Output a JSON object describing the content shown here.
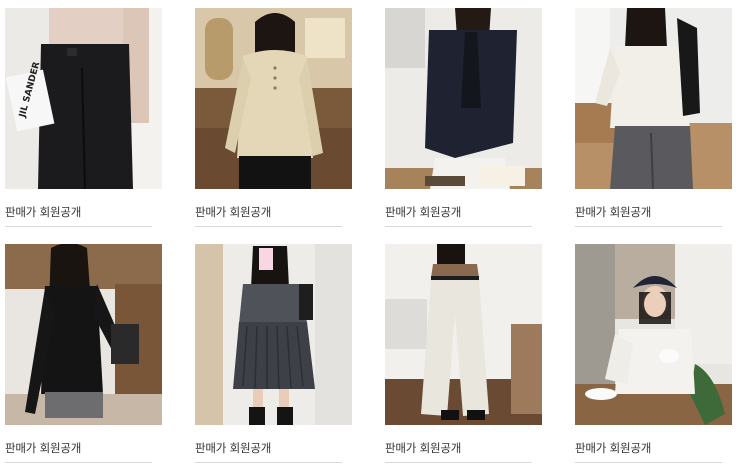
{
  "products": [
    {
      "price_label": "판매가 회원공개",
      "icon": "product-photo"
    },
    {
      "price_label": "판매가 회원공개",
      "icon": "product-photo"
    },
    {
      "price_label": "판매가 회원공개",
      "icon": "product-photo"
    },
    {
      "price_label": "판매가 회원공개",
      "icon": "product-photo"
    },
    {
      "price_label": "판매가 회원공개",
      "icon": "product-photo"
    },
    {
      "price_label": "판매가 회원공개",
      "icon": "product-photo"
    },
    {
      "price_label": "판매가 회원공개",
      "icon": "product-photo"
    },
    {
      "price_label": "판매가 회원공개",
      "icon": "product-photo"
    }
  ],
  "magazine_text": "JIL SANDER",
  "colors": {
    "text": "#333333",
    "divider": "#d9d9d9"
  }
}
